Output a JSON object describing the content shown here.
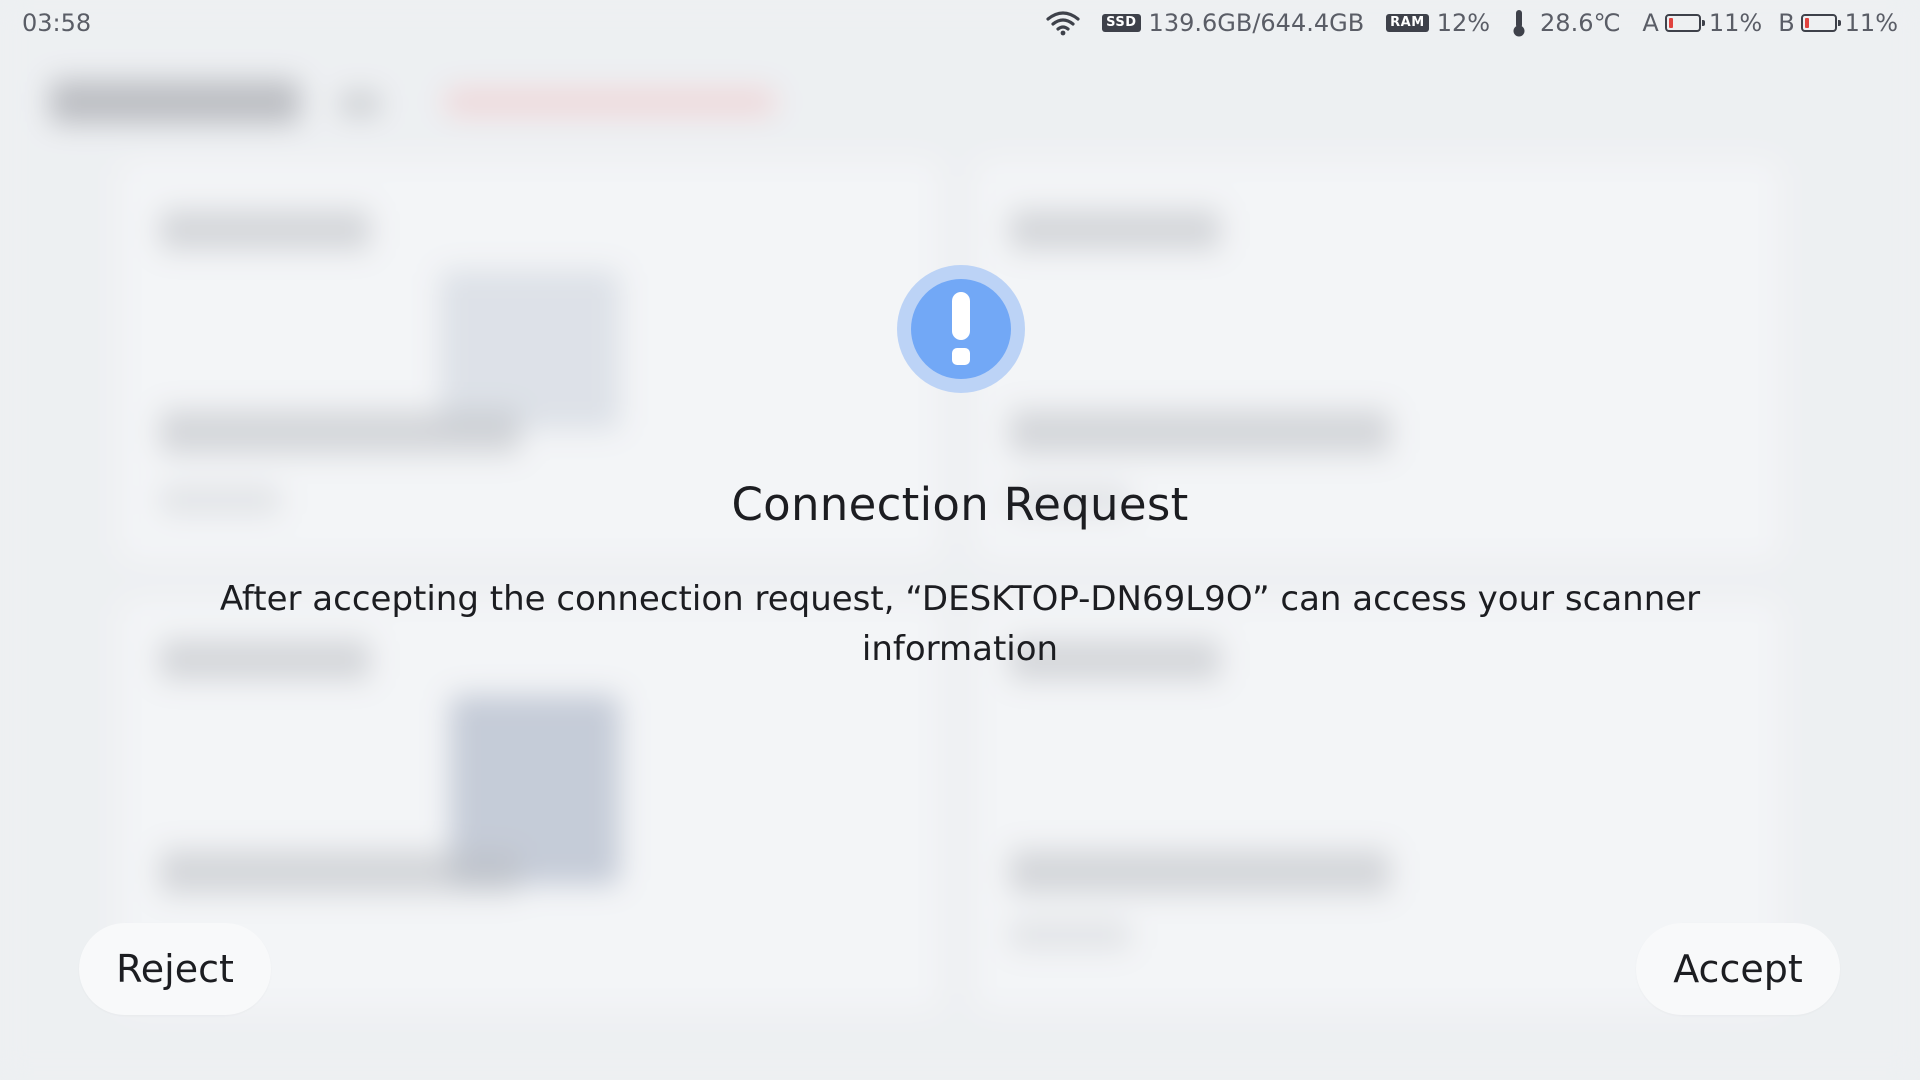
{
  "status_bar": {
    "time": "03:58",
    "storage_tag": "SSD",
    "storage": "139.6GB/644.4GB",
    "ram_tag": "RAM",
    "ram": "12%",
    "temperature": "28.6℃",
    "battery_a_label": "A",
    "battery_a": "11%",
    "battery_b_label": "B",
    "battery_b": "11%",
    "icons": [
      "wifi-icon",
      "thermometer-icon",
      "battery-icon"
    ]
  },
  "dialog": {
    "icon": "exclamation-icon",
    "title": "Connection Request",
    "message": "After accepting the connection request, “DESKTOP-DN69L9O” can access your scanner information",
    "reject_label": "Reject",
    "accept_label": "Accept"
  },
  "colors": {
    "accent": "#72a8f6",
    "accent_ring": "#bcd3f6",
    "battery_low": "#e0433f",
    "button_bg": "#f8f9fa"
  }
}
